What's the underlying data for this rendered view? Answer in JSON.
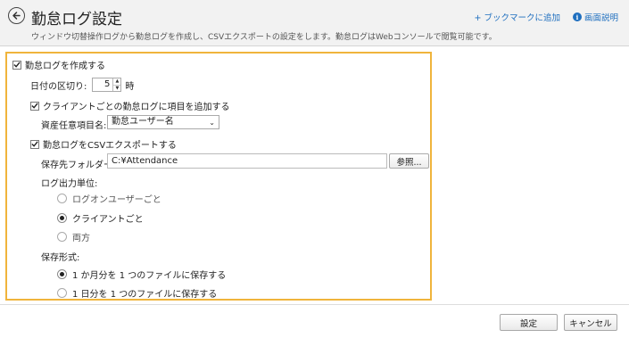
{
  "header": {
    "title": "勤怠ログ設定",
    "description": "ウィンドウ切替操作ログから勤怠ログを作成し、CSVエクスポートの設定をします。勤怠ログはWebコンソールで閲覧可能です。",
    "bookmark_link": "+ ブックマークに追加",
    "help_link": "画面説明",
    "help_icon_glyph": "i"
  },
  "form": {
    "create_log": {
      "label": "勤怠ログを作成する",
      "checked": true
    },
    "day_boundary": {
      "label": "日付の区切り:",
      "value": "5",
      "unit": "時"
    },
    "add_client_item": {
      "label": "クライアントごとの勤怠ログに項目を追加する",
      "checked": true
    },
    "asset_item": {
      "label": "資産任意項目名:",
      "selected": "勤怠ユーザー名"
    },
    "csv_export": {
      "label": "勤怠ログをCSVエクスポートする",
      "checked": true
    },
    "save_folder": {
      "label": "保存先フォルダー",
      "required_mark": "*",
      "colon": ":",
      "value": "C:¥Attendance",
      "browse_button": "参照..."
    },
    "output_unit": {
      "label": "ログ出力単位:",
      "options": [
        {
          "label": "ログオンユーザーごと",
          "selected": false
        },
        {
          "label": "クライアントごと",
          "selected": true
        },
        {
          "label": "両方",
          "selected": false
        }
      ]
    },
    "save_format": {
      "label": "保存形式:",
      "options": [
        {
          "label": "1 か月分を 1 つのファイルに保存する",
          "selected": true
        },
        {
          "label": "1 日分を 1 つのファイルに保存する",
          "selected": false
        }
      ]
    }
  },
  "footer": {
    "ok_button": "設定",
    "cancel_button": "キャンセル"
  },
  "colors": {
    "highlight_border": "#f0b43c",
    "link": "#1f6fbf",
    "required": "#d0021b"
  }
}
